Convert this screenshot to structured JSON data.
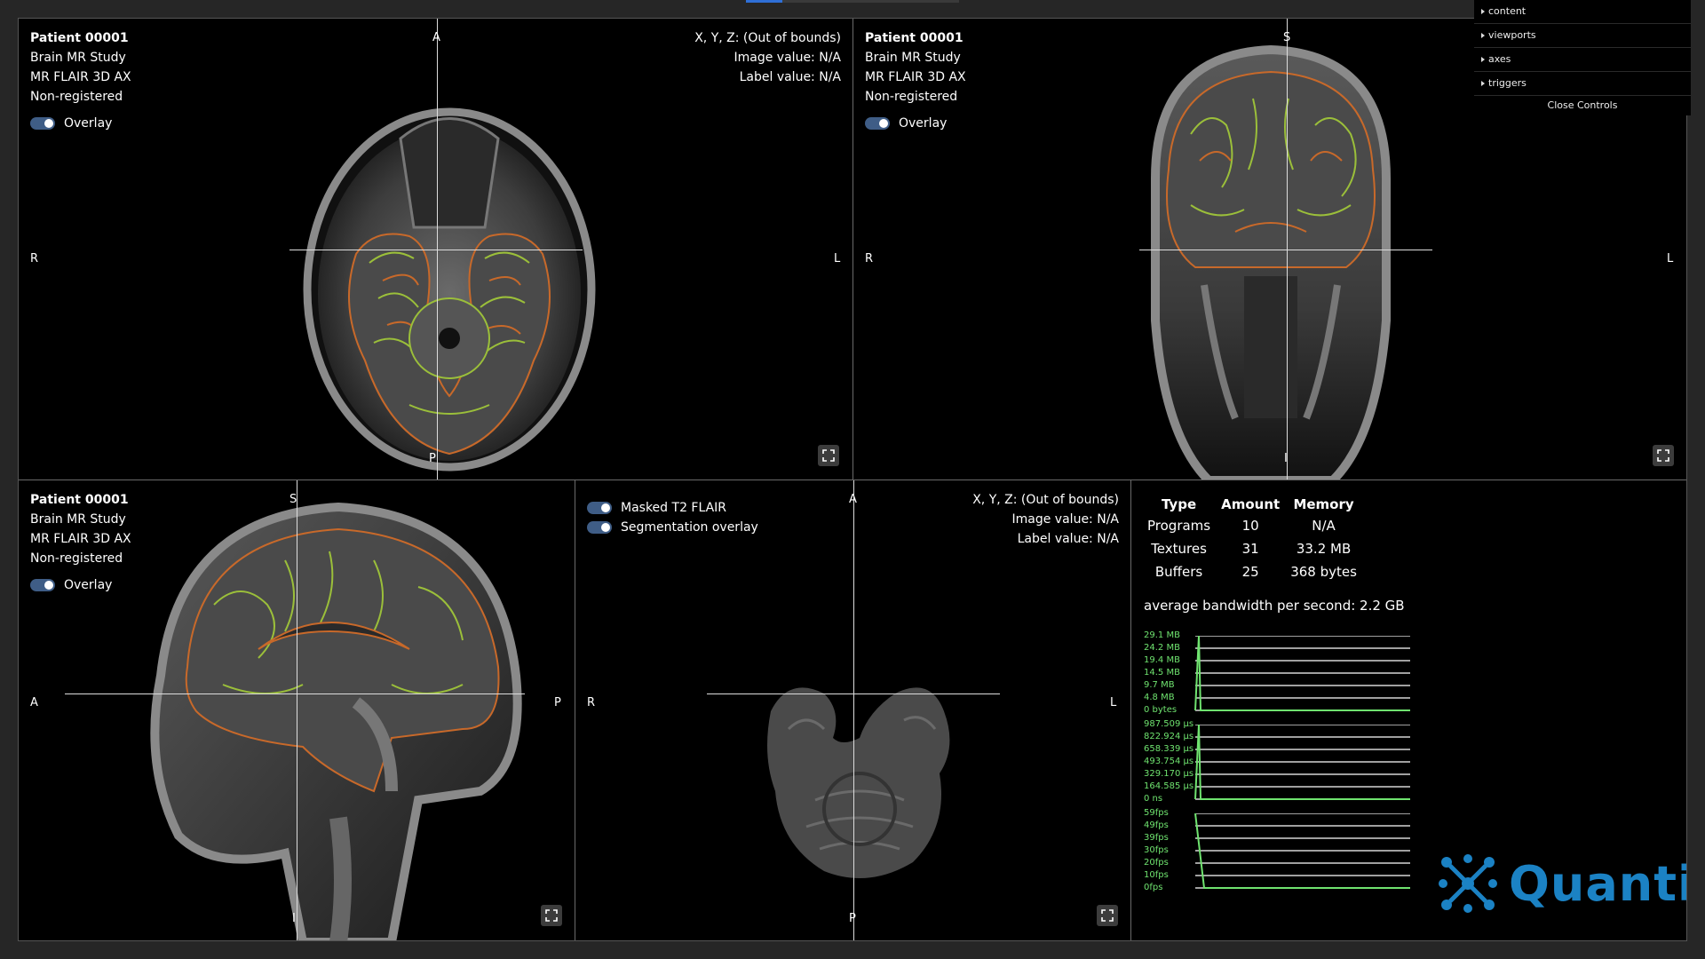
{
  "viewports": {
    "axial": {
      "patient": "Patient 00001",
      "study": "Brain MR Study",
      "series": "MR FLAIR 3D AX",
      "registration": "Non-registered",
      "overlay_label": "Overlay",
      "coords": "X, Y, Z: (Out of bounds)",
      "image_value": "Image value: N/A",
      "label_value": "Label value: N/A",
      "orient": {
        "top": "A",
        "bottom": "P",
        "left": "R",
        "right": "L"
      }
    },
    "coronal": {
      "patient": "Patient 00001",
      "study": "Brain MR Study",
      "series": "MR FLAIR 3D AX",
      "registration": "Non-registered",
      "overlay_label": "Overlay",
      "orient": {
        "top": "S",
        "bottom": "I",
        "left": "R",
        "right": "L"
      }
    },
    "sagittal": {
      "patient": "Patient 00001",
      "study": "Brain MR Study",
      "series": "MR FLAIR 3D AX",
      "registration": "Non-registered",
      "overlay_label": "Overlay",
      "orient": {
        "top": "S",
        "bottom": "I",
        "left": "A",
        "right": "P"
      }
    },
    "masked": {
      "toggle1": "Masked T2 FLAIR",
      "toggle2": "Segmentation overlay",
      "coords": "X, Y, Z: (Out of bounds)",
      "image_value": "Image value: N/A",
      "label_value": "Label value: N/A",
      "orient": {
        "top": "A",
        "bottom": "P",
        "left": "R",
        "right": "L"
      }
    }
  },
  "stats": {
    "headers": [
      "Type",
      "Amount",
      "Memory"
    ],
    "rows": [
      [
        "Programs",
        "10",
        "N/A"
      ],
      [
        "Textures",
        "31",
        "33.2 MB"
      ],
      [
        "Buffers",
        "25",
        "368 bytes"
      ]
    ],
    "bandwidth": "average bandwidth per second: 2.2 GB",
    "memory_graph": [
      "29.1 MB",
      "24.2 MB",
      "19.4 MB",
      "14.5 MB",
      "9.7 MB",
      "4.8 MB",
      "0 bytes"
    ],
    "time_graph": [
      "987.509 µs",
      "822.924 µs",
      "658.339 µs",
      "493.754 µs",
      "329.170 µs",
      "164.585 µs",
      "0 ns"
    ],
    "fps_graph": [
      "59fps",
      "49fps",
      "39fps",
      "30fps",
      "20fps",
      "10fps",
      "0fps"
    ]
  },
  "controls": {
    "items": [
      "content",
      "viewports",
      "axes",
      "triggers"
    ],
    "close": "Close Controls"
  },
  "logo": {
    "text": "Quantib",
    "color": "#1b82c4"
  },
  "colors": {
    "graph_green": "#6fe36f",
    "toggle": "#3f5d86",
    "seg_orange": "#c8692a",
    "seg_green": "#9bbf3a"
  }
}
